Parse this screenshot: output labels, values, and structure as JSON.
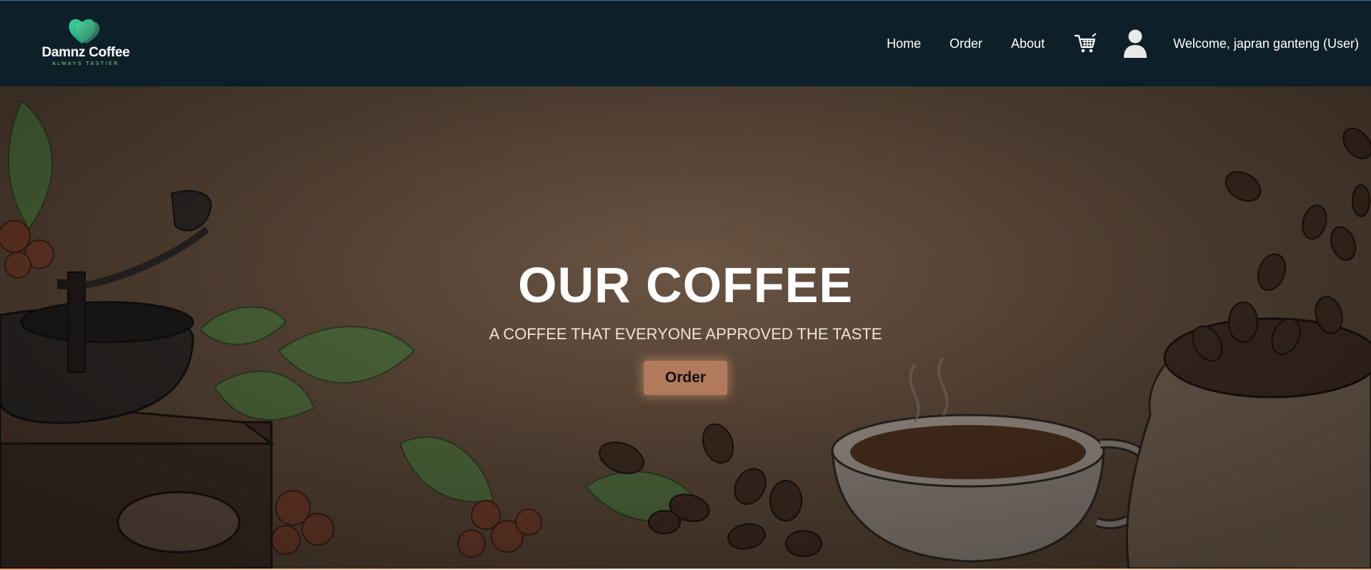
{
  "brand": {
    "name": "Damnz Coffee",
    "tagline": "ALWAYS TASTIER",
    "accent": "#2ec27e"
  },
  "nav": {
    "links": [
      {
        "label": "Home"
      },
      {
        "label": "Order"
      },
      {
        "label": "About"
      }
    ],
    "cart_icon": "cart-icon",
    "user_icon": "user-icon",
    "welcome_text": "Welcome, japran ganteng (User)"
  },
  "hero": {
    "title": "OUR COFFEE",
    "subtitle": "A COFFEE THAT EVERYONE APPROVED THE TASTE",
    "button_label": "Order",
    "button_color": "#b27a5c",
    "background_color": "#5c4838"
  },
  "colors": {
    "navbar": "#0d2029",
    "text": "#ffffff"
  }
}
